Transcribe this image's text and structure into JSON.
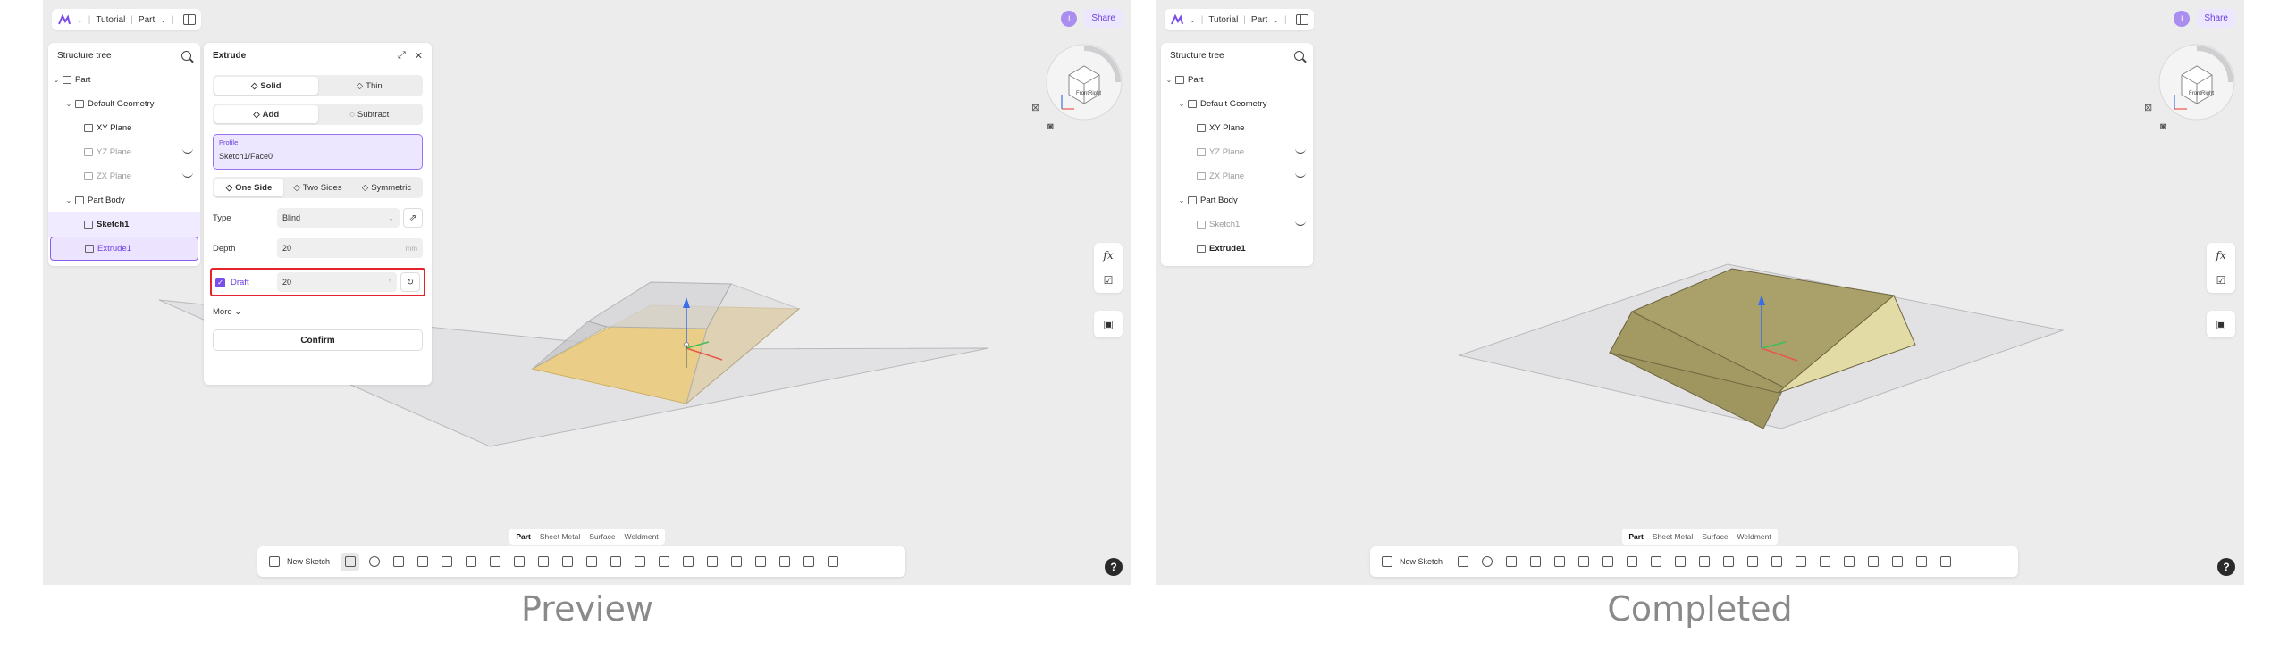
{
  "topbar": {
    "project": "Tutorial",
    "document": "Part",
    "share": "Share",
    "user_initial": "I"
  },
  "tree": {
    "title": "Structure tree",
    "root": "Part",
    "default_geometry": "Default Geometry",
    "xy": "XY Plane",
    "yz": "YZ Plane",
    "zx": "ZX Plane",
    "body": "Part Body",
    "sketch": "Sketch1",
    "extrude": "Extrude1"
  },
  "extrude": {
    "title": "Extrude",
    "solid": "Solid",
    "thin": "Thin",
    "add": "Add",
    "subtract": "Subtract",
    "profile_label": "Profile",
    "profile_value": "Sketch1/Face0",
    "one_side": "One Side",
    "two_sides": "Two Sides",
    "symmetric": "Symmetric",
    "type_label": "Type",
    "type_value": "Blind",
    "depth_label": "Depth",
    "depth_value": "20",
    "depth_unit": "mm",
    "draft_label": "Draft",
    "draft_value": "20",
    "draft_unit": "°",
    "more": "More",
    "confirm": "Confirm"
  },
  "viewcube": {
    "front": "Front",
    "right": "Right"
  },
  "bottom_tabs": [
    "Part",
    "Sheet Metal",
    "Surface",
    "Weldment"
  ],
  "toolbar": {
    "new_sketch": "New Sketch"
  },
  "captions": {
    "left": "Preview",
    "right": "Completed"
  },
  "colors": {
    "accent": "#7a4ee8",
    "highlight": "#e3242b",
    "preview_face": "#e9c67a",
    "completed_face": "#b0a56c"
  }
}
